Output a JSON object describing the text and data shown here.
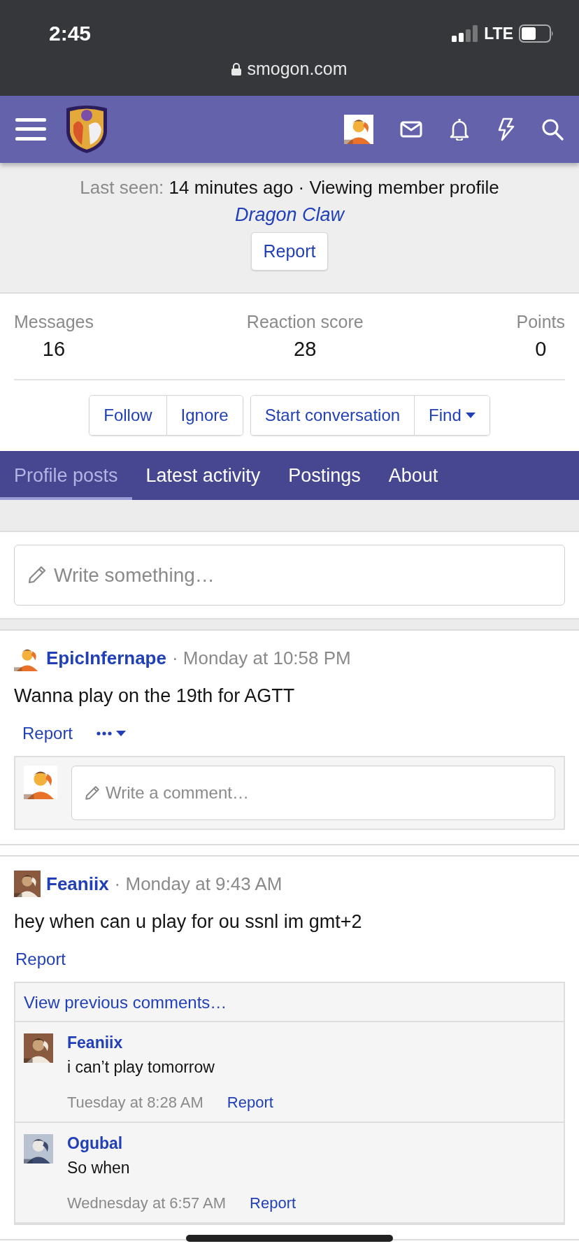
{
  "status_bar": {
    "time": "2:45",
    "network": "LTE"
  },
  "address_bar": {
    "url": "smogon.com"
  },
  "profile": {
    "last_seen_label": "Last seen:",
    "last_seen": "14 minutes ago · Viewing member profile",
    "activity_link": "Dragon Claw",
    "report": "Report"
  },
  "stats": [
    {
      "label": "Messages",
      "value": "16"
    },
    {
      "label": "Reaction score",
      "value": "28"
    },
    {
      "label": "Points",
      "value": "0"
    }
  ],
  "action_groups": [
    [
      {
        "label": "Follow",
        "kind": "button"
      },
      {
        "label": "Ignore",
        "kind": "button"
      }
    ],
    [
      {
        "label": "Start conversation",
        "kind": "button"
      },
      {
        "label": "Find",
        "kind": "dropdown"
      }
    ]
  ],
  "tabs": [
    {
      "label": "Profile posts",
      "selected": true
    },
    {
      "label": "Latest activity",
      "selected": false
    },
    {
      "label": "Postings",
      "selected": false
    },
    {
      "label": "About",
      "selected": false
    }
  ],
  "composer": {
    "placeholder": "Write something…"
  },
  "posts": [
    {
      "author": "EpicInfernape",
      "time": "· Monday at 10:58 PM",
      "text": "Wanna play on the 19th for AGTT",
      "report": "Report",
      "menu": true,
      "reply_placeholder": "Write a comment…"
    },
    {
      "author": "Feaniix",
      "time": "· Monday at 9:43 AM",
      "text": "hey when can u play for ou ssnl im gmt+2",
      "report": "Report",
      "menu": false,
      "previous_comments": "View previous comments…",
      "comments": [
        {
          "author": "Feaniix",
          "text": "i can’t play tomorrow",
          "time": "Tuesday at 8:28 AM",
          "report": "Report"
        },
        {
          "author": "Ogubal",
          "text": "So when",
          "time": "Wednesday at 6:57 AM",
          "report": "Report"
        }
      ]
    }
  ]
}
